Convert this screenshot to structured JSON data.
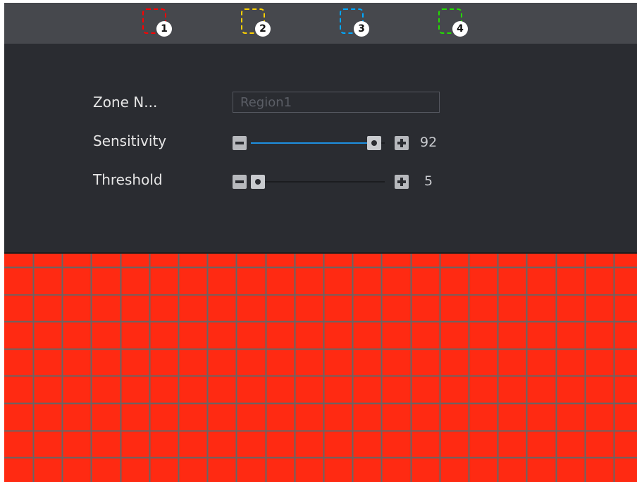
{
  "zones": [
    {
      "number": "1",
      "color": "#ff0000"
    },
    {
      "number": "2",
      "color": "#ffd200"
    },
    {
      "number": "3",
      "color": "#00a8ff"
    },
    {
      "number": "4",
      "color": "#22dd00"
    }
  ],
  "form": {
    "zone_name_label": "Zone N...",
    "zone_name_value": "Region1",
    "sensitivity": {
      "label": "Sensitivity",
      "value": "92",
      "percent": 92,
      "minus_icon": "minus-icon",
      "plus_icon": "plus-icon"
    },
    "threshold": {
      "label": "Threshold",
      "value": "5",
      "percent": 5,
      "minus_icon": "minus-icon",
      "plus_icon": "plus-icon"
    }
  },
  "grid": {
    "cell_color": "#ff2a12",
    "line_color": "#666666",
    "columns": 22,
    "rows": 18
  },
  "colors": {
    "accent": "#1e90e0",
    "background": "#2a2c31",
    "bar": "#46484d"
  }
}
